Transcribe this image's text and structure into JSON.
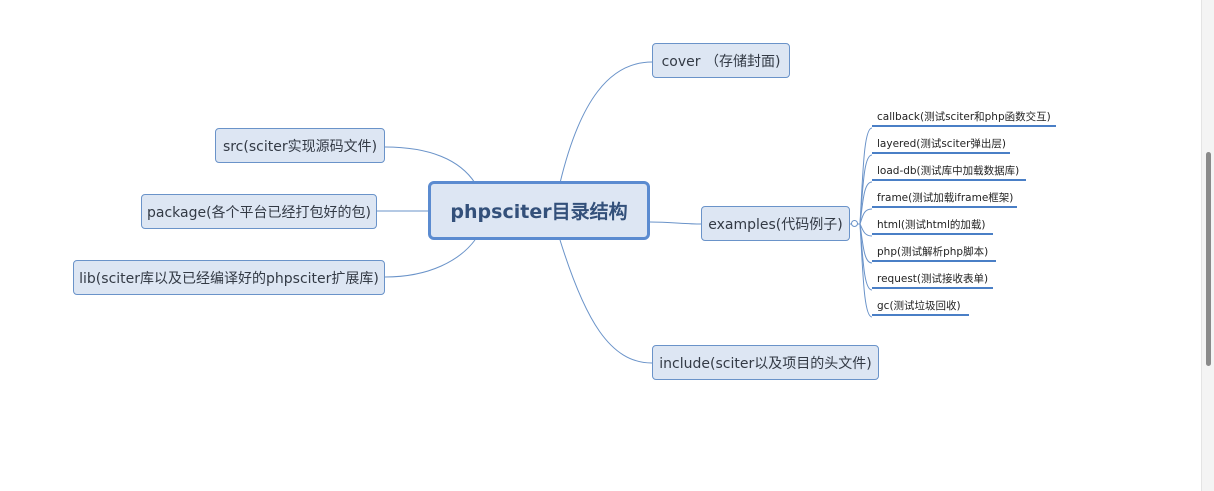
{
  "mindmap": {
    "root": "phpsciter目录结构",
    "left": [
      "src(sciter实现源码文件)",
      "package(各个平台已经打包好的包)",
      "lib(sciter库以及已经编译好的phpsciter扩展库)"
    ],
    "right": {
      "cover": "cover （存储封面)",
      "examples": "examples(代码例子)",
      "include": "include(sciter以及项目的头文件)"
    },
    "examples_children": [
      "callback(测试sciter和php函数交互)",
      "layered(测试sciter弹出层)",
      "load-db(测试库中加载数据库)",
      "frame(测试加载iframe框架)",
      "html(测试html的加载)",
      "php(测试解析php脚本)",
      "request(测试接收表单)",
      "gc(测试垃圾回收)"
    ]
  },
  "colors": {
    "node_fill": "#dde6f3",
    "node_border": "#6a93c9",
    "root_border": "#5b8bd0",
    "connector": "#6a93c9",
    "leaf_underline": "#4a7fc6"
  }
}
